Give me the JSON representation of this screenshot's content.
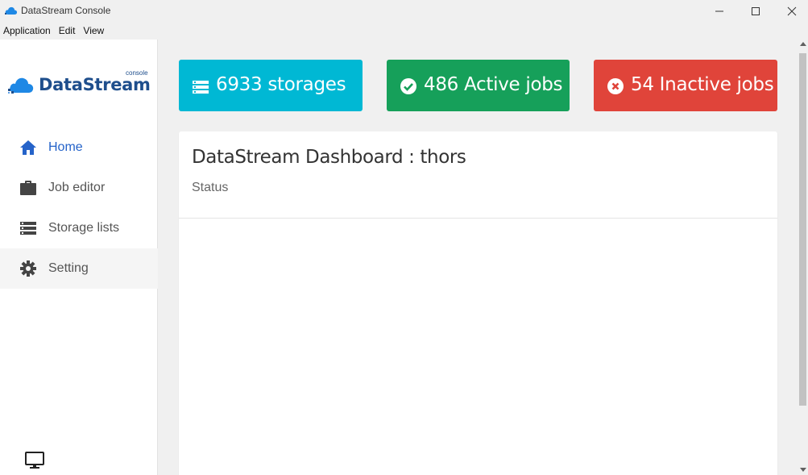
{
  "window": {
    "title": "DataStream Console",
    "icons": {
      "app": "cloud-icon",
      "minimize": "minimize-icon",
      "maximize": "maximize-icon",
      "close": "close-icon"
    }
  },
  "menubar": {
    "items": [
      {
        "label": "Application"
      },
      {
        "label": "Edit"
      },
      {
        "label": "View"
      }
    ]
  },
  "sidebar": {
    "logo": {
      "text": "DataStream",
      "sub": "console"
    },
    "items": [
      {
        "label": "Home",
        "icon": "home-icon",
        "active": true
      },
      {
        "label": "Job editor",
        "icon": "briefcase-icon"
      },
      {
        "label": "Storage lists",
        "icon": "list-icon"
      },
      {
        "label": "Setting",
        "icon": "gear-icon",
        "hovered": true
      }
    ],
    "footer_icon": "monitor-icon"
  },
  "stats": [
    {
      "text": "6933 storages",
      "icon": "list-icon",
      "color": "#00b8d4"
    },
    {
      "text": "486 Active jobs",
      "icon": "check-circle-icon",
      "color": "#16a05a"
    },
    {
      "text": "54 Inactive jobs",
      "icon": "x-circle-icon",
      "color": "#e0443a"
    }
  ],
  "dashboard": {
    "title": "DataStream Dashboard : thors",
    "subtitle": "Status"
  },
  "colors": {
    "accent": "#2563c9",
    "brand": "#1e4e8c"
  }
}
